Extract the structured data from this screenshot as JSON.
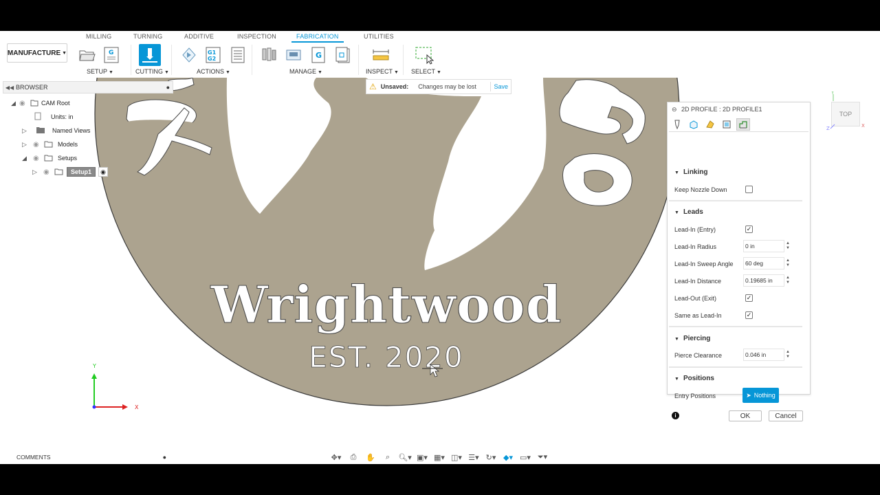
{
  "ribbon": {
    "workspace": "MANUFACTURE",
    "tabs": [
      "MILLING",
      "TURNING",
      "ADDITIVE",
      "INSPECTION",
      "FABRICATION",
      "UTILITIES"
    ],
    "active_tab": "FABRICATION",
    "groups": {
      "setup": "SETUP",
      "cutting": "CUTTING",
      "actions": "ACTIONS",
      "manage": "MANAGE",
      "inspect": "INSPECT",
      "select": "SELECT"
    }
  },
  "browser": {
    "title": "BROWSER",
    "items": {
      "root": "CAM Root",
      "units": "Units: in",
      "named_views": "Named Views",
      "models": "Models",
      "setups": "Setups",
      "setup1": "Setup1"
    }
  },
  "notice": {
    "label": "Unsaved:",
    "message": "Changes may be lost",
    "action": "Save"
  },
  "canvas": {
    "main_text": "Wrightwood",
    "sub_text": "EST. 2020",
    "left_partial": "YO",
    "right_partial": "ge",
    "plate_color": "#aca38f"
  },
  "dialog": {
    "title": "2D PROFILE : 2D PROFILE1",
    "sections": {
      "linking": "Linking",
      "leads": "Leads",
      "piercing": "Piercing",
      "positions": "Positions"
    },
    "fields": {
      "keep_nozzle_down": "Keep Nozzle Down",
      "lead_in_entry": "Lead-In (Entry)",
      "lead_in_radius": "Lead-In Radius",
      "lead_in_radius_value": "0 in",
      "lead_in_sweep_angle": "Lead-In Sweep Angle",
      "lead_in_sweep_angle_value": "60 deg",
      "lead_in_distance": "Lead-In Distance",
      "lead_in_distance_value": "0.19685 in",
      "lead_out_exit": "Lead-Out (Exit)",
      "same_as_lead_in": "Same as Lead-In",
      "pierce_clearance": "Pierce Clearance",
      "pierce_clearance_value": "0.046 in",
      "entry_positions": "Entry Positions",
      "entry_positions_value": "Nothing"
    },
    "checks": {
      "keep_nozzle_down": false,
      "lead_in_entry": true,
      "lead_out_exit": true,
      "same_as_lead_in": true
    },
    "ok": "OK",
    "cancel": "Cancel"
  },
  "viewcube": {
    "face": "TOP"
  },
  "bottom": {
    "comments": "COMMENTS"
  },
  "colors": {
    "accent": "#0696d7",
    "plate": "#aca38f",
    "axis_x": "#d22",
    "axis_y": "#2c2"
  }
}
